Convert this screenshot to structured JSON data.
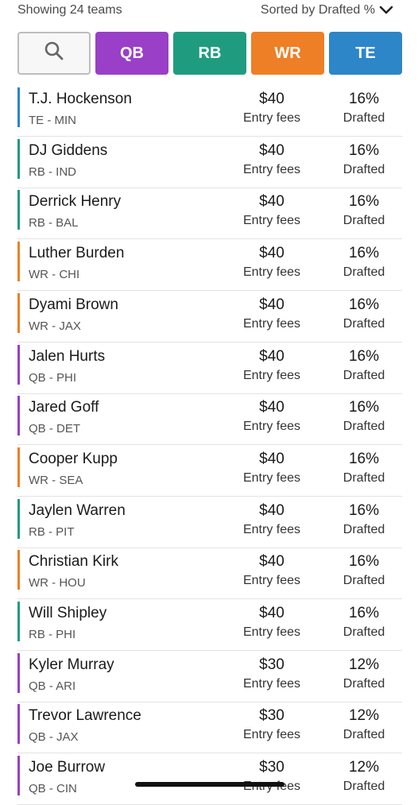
{
  "header": {
    "showing_text": "Showing 24 teams",
    "sorted_text": "Sorted by Drafted %",
    "sort_icon": "chevron-down-icon"
  },
  "filters": {
    "search_icon": "search-icon",
    "buttons": [
      {
        "label": "QB",
        "color": "#9a3fc8"
      },
      {
        "label": "RB",
        "color": "#1f9c80"
      },
      {
        "label": "WR",
        "color": "#ee7f26"
      },
      {
        "label": "TE",
        "color": "#2c86c8"
      }
    ]
  },
  "position_colors": {
    "QB": "#9a3fc8",
    "RB": "#1f9c80",
    "WR": "#ee7f26",
    "TE": "#2c86c8"
  },
  "players": [
    {
      "name": "T.J. Hockenson",
      "team": "TE - MIN",
      "pos": "TE",
      "fee": "$40",
      "fee_label": "Entry fees",
      "pct": "16%",
      "pct_label": "Drafted"
    },
    {
      "name": "DJ Giddens",
      "team": "RB - IND",
      "pos": "RB",
      "fee": "$40",
      "fee_label": "Entry fees",
      "pct": "16%",
      "pct_label": "Drafted"
    },
    {
      "name": "Derrick Henry",
      "team": "RB - BAL",
      "pos": "RB",
      "fee": "$40",
      "fee_label": "Entry fees",
      "pct": "16%",
      "pct_label": "Drafted"
    },
    {
      "name": "Luther Burden",
      "team": "WR - CHI",
      "pos": "WR",
      "fee": "$40",
      "fee_label": "Entry fees",
      "pct": "16%",
      "pct_label": "Drafted"
    },
    {
      "name": "Dyami Brown",
      "team": "WR - JAX",
      "pos": "WR",
      "fee": "$40",
      "fee_label": "Entry fees",
      "pct": "16%",
      "pct_label": "Drafted"
    },
    {
      "name": "Jalen Hurts",
      "team": "QB - PHI",
      "pos": "QB",
      "fee": "$40",
      "fee_label": "Entry fees",
      "pct": "16%",
      "pct_label": "Drafted"
    },
    {
      "name": "Jared Goff",
      "team": "QB - DET",
      "pos": "QB",
      "fee": "$40",
      "fee_label": "Entry fees",
      "pct": "16%",
      "pct_label": "Drafted"
    },
    {
      "name": "Cooper Kupp",
      "team": "WR - SEA",
      "pos": "WR",
      "fee": "$40",
      "fee_label": "Entry fees",
      "pct": "16%",
      "pct_label": "Drafted"
    },
    {
      "name": "Jaylen Warren",
      "team": "RB - PIT",
      "pos": "RB",
      "fee": "$40",
      "fee_label": "Entry fees",
      "pct": "16%",
      "pct_label": "Drafted"
    },
    {
      "name": "Christian Kirk",
      "team": "WR - HOU",
      "pos": "WR",
      "fee": "$40",
      "fee_label": "Entry fees",
      "pct": "16%",
      "pct_label": "Drafted"
    },
    {
      "name": "Will Shipley",
      "team": "RB - PHI",
      "pos": "RB",
      "fee": "$40",
      "fee_label": "Entry fees",
      "pct": "16%",
      "pct_label": "Drafted"
    },
    {
      "name": "Kyler Murray",
      "team": "QB - ARI",
      "pos": "QB",
      "fee": "$30",
      "fee_label": "Entry fees",
      "pct": "12%",
      "pct_label": "Drafted"
    },
    {
      "name": "Trevor Lawrence",
      "team": "QB - JAX",
      "pos": "QB",
      "fee": "$30",
      "fee_label": "Entry fees",
      "pct": "12%",
      "pct_label": "Drafted"
    },
    {
      "name": "Joe Burrow",
      "team": "QB - CIN",
      "pos": "QB",
      "fee": "$30",
      "fee_label": "Entry fees",
      "pct": "12%",
      "pct_label": "Drafted"
    }
  ]
}
